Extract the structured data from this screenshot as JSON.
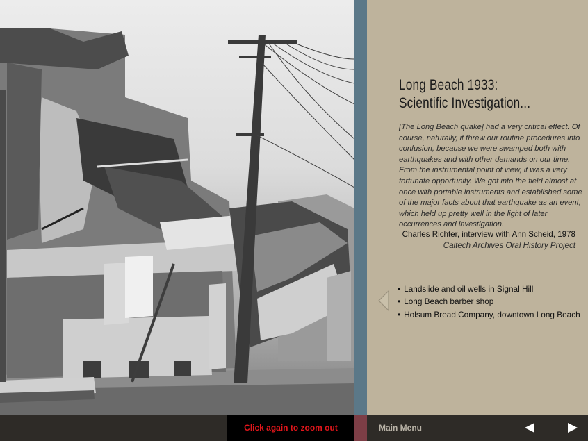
{
  "panel": {
    "title_line1": "Long Beach 1933:",
    "title_line2": "Scientific Investigation...",
    "quote": "[The Long Beach quake] had a very critical effect. Of course, naturally, it threw our routine procedures into confusion, because we were swamped both with earthquakes and with other demands on our time. From the instrumental point of view, it was a very fortunate opportunity. We got into the field almost at once with portable instruments and established some of the major facts about that earthquake as an event, which held up pretty well in the light of later occurrences and investigation.",
    "attribution": "Charles Richter, interview with Ann Scheid, 1978",
    "source": "Caltech Archives Oral History Project",
    "links": [
      "Landslide and oil wells in Signal Hill",
      "Long Beach barber shop",
      "Holsum Bread Company, downtown Long Beach"
    ]
  },
  "bottombar": {
    "zoom_label": "Click again to zoom out",
    "menu_label": "Main Menu"
  },
  "icons": {
    "prev_link": "triangle-left-outline-icon",
    "prev_nav": "triangle-left-icon",
    "next_nav": "triangle-right-icon"
  },
  "colors": {
    "panel_bg": "#beb39c",
    "divider": "#5b7888",
    "bar_bg": "#2e2b27",
    "zoom_text": "#e3161b",
    "accent": "#7d3e46"
  }
}
